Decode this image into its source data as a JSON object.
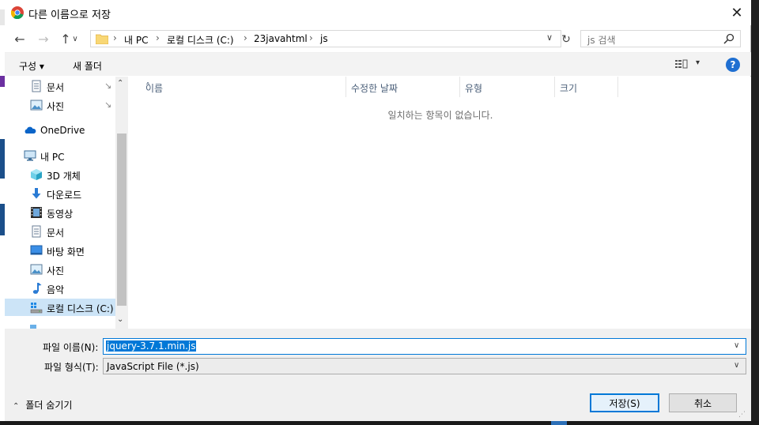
{
  "window": {
    "title": "다른 이름으로 저장",
    "close_glyph": "✕"
  },
  "nav_buttons": {
    "back": "←",
    "forward": "→",
    "up": "↑"
  },
  "address": {
    "crumbs": [
      "내 PC",
      "로컬 디스크 (C:)",
      "23javahtml",
      "js"
    ],
    "separator": "›",
    "dropdown": "∨",
    "refresh": "↻"
  },
  "search": {
    "placeholder": "js 검색"
  },
  "toolbar": {
    "organize": "구성 ▾",
    "new_folder": "새 폴더",
    "view_drop": "▾",
    "help": "?"
  },
  "nav_pane": {
    "items": [
      {
        "label": "문서",
        "icon": "document-icon",
        "pinned": true
      },
      {
        "label": "사진",
        "icon": "pictures-icon",
        "pinned": true
      },
      {
        "label": "OneDrive",
        "icon": "onedrive-icon",
        "pinned": false
      },
      {
        "label": "내 PC",
        "icon": "pc-icon",
        "pinned": false
      },
      {
        "label": "3D 개체",
        "icon": "3d-objects-icon",
        "pinned": false
      },
      {
        "label": "다운로드",
        "icon": "download-icon",
        "pinned": false
      },
      {
        "label": "동영상",
        "icon": "video-icon",
        "pinned": false
      },
      {
        "label": "문서",
        "icon": "document-icon",
        "pinned": false
      },
      {
        "label": "바탕 화면",
        "icon": "desktop-icon",
        "pinned": false
      },
      {
        "label": "사진",
        "icon": "pictures-icon",
        "pinned": false
      },
      {
        "label": "음악",
        "icon": "music-icon",
        "pinned": false
      },
      {
        "label": "로컬 디스크 (C:)",
        "icon": "drive-icon",
        "pinned": false,
        "selected": true
      }
    ],
    "pin_glyph": "📌",
    "scroll_up": "⌃",
    "scroll_down": "⌄"
  },
  "file_list": {
    "columns": [
      "이름",
      "수정한 날짜",
      "유형",
      "크기"
    ],
    "sort_glyph": "˄",
    "empty_message": "일치하는 항목이 없습니다."
  },
  "bottom": {
    "filename_label": "파일 이름(N):",
    "filename_value": "jquery-3.7.1.min.js",
    "filetype_label": "파일 형식(T):",
    "filetype_value": "JavaScript File (*.js)",
    "dropdown_glyph": "∨",
    "hide_folders": "폴더 숨기기",
    "hide_caret": "⌃",
    "save": "저장(S)",
    "cancel": "취소",
    "grip": "⋰"
  },
  "colors": {
    "accent": "#0078d7",
    "selection": "#cce4f7",
    "help": "#1f6fd1"
  }
}
